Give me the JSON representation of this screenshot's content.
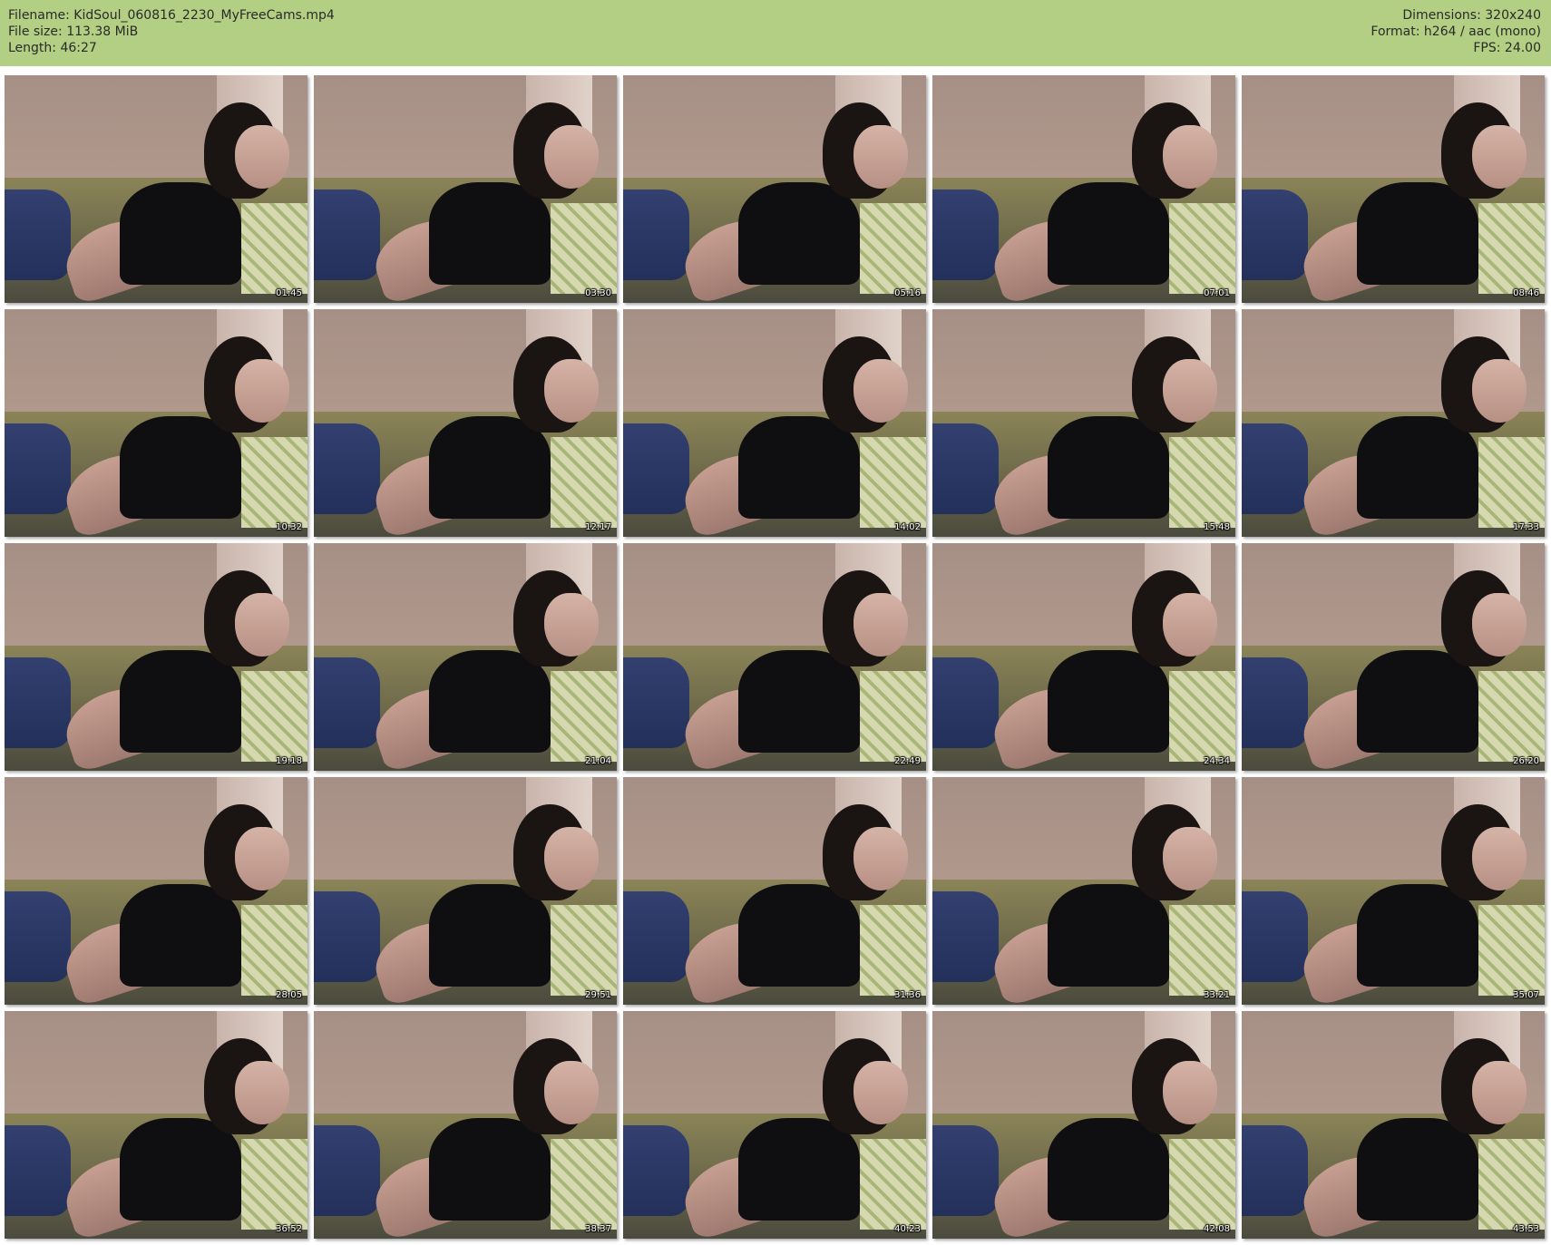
{
  "header": {
    "filename": "Filename: KidSoul_060816_2230_MyFreeCams.mp4",
    "filesize": "File size: 113.38 MiB",
    "length": "Length: 46:27",
    "dimensions": "Dimensions: 320x240",
    "format": "Format: h264 / aac (mono)",
    "fps": "FPS: 24.00"
  },
  "colors": {
    "header_bg": "#b2cf83",
    "page_bg": "#ffffff"
  },
  "thumbnails": [
    {
      "timestamp": "01:45"
    },
    {
      "timestamp": "03:30"
    },
    {
      "timestamp": "05:16"
    },
    {
      "timestamp": "07:01"
    },
    {
      "timestamp": "08:46"
    },
    {
      "timestamp": "10:32"
    },
    {
      "timestamp": "12:17"
    },
    {
      "timestamp": "14:02"
    },
    {
      "timestamp": "15:48"
    },
    {
      "timestamp": "17:33"
    },
    {
      "timestamp": "19:18"
    },
    {
      "timestamp": "21:04"
    },
    {
      "timestamp": "22:49"
    },
    {
      "timestamp": "24:34"
    },
    {
      "timestamp": "26:20"
    },
    {
      "timestamp": "28:05"
    },
    {
      "timestamp": "29:51"
    },
    {
      "timestamp": "31:36"
    },
    {
      "timestamp": "33:21"
    },
    {
      "timestamp": "35:07"
    },
    {
      "timestamp": "36:52"
    },
    {
      "timestamp": "38:37"
    },
    {
      "timestamp": "40:23"
    },
    {
      "timestamp": "42:08"
    },
    {
      "timestamp": "43:53"
    }
  ]
}
